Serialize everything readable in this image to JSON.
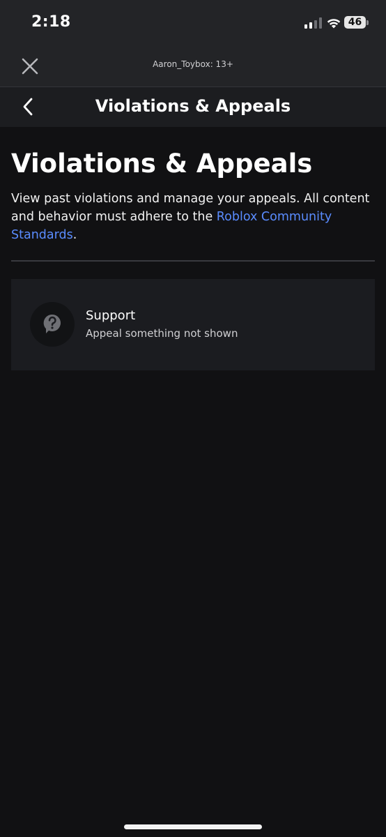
{
  "status_bar": {
    "time": "2:18",
    "battery_percent": "46",
    "signal_bars_active": 2,
    "signal_bars_total": 4
  },
  "account_bar": {
    "account_label": "Aaron_Toybox: 13+",
    "close_icon": "close-icon"
  },
  "nav_bar": {
    "title": "Violations & Appeals",
    "back_icon": "chevron-left-icon"
  },
  "page": {
    "title": "Violations & Appeals",
    "intro_text": "View past violations and manage your appeals. All content and behavior must adhere to the ",
    "link_text": "Roblox Community Standards",
    "intro_end": "."
  },
  "support_card": {
    "title": "Support",
    "subtitle": "Appeal something not shown",
    "icon": "help-icon"
  },
  "colors": {
    "background": "#111113",
    "top_bar": "#232427",
    "nav_bar": "#1c1d20",
    "card": "#1b1c20",
    "link": "#5a8cff"
  }
}
